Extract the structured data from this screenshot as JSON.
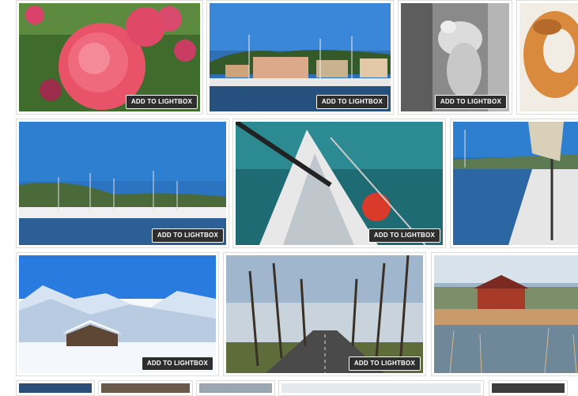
{
  "gallery": {
    "add_to_lightbox_label": "ADD TO LIGHTBOX",
    "photos": [
      {
        "subject": "pink-roses"
      },
      {
        "subject": "harbor-marina-village"
      },
      {
        "subject": "marble-statue"
      },
      {
        "subject": "pastry-plate"
      },
      {
        "subject": "marina-sailboats"
      },
      {
        "subject": "sailboat-deck-closeup"
      },
      {
        "subject": "sailboat-stern-marina"
      },
      {
        "subject": "snowy-mountain-cabin"
      },
      {
        "subject": "tree-lined-road"
      },
      {
        "subject": "lakeside-house-reeds"
      }
    ]
  }
}
